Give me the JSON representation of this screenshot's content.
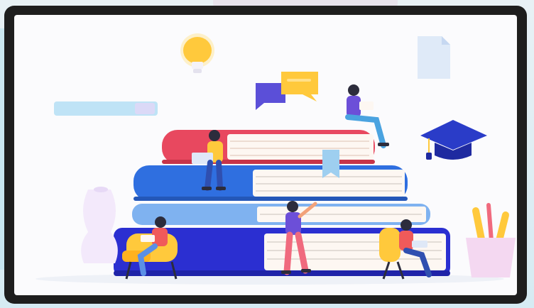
{
  "scene": {
    "colors": {
      "frame": "#1e1e1e",
      "screen": "#fbfbfd",
      "book_red": "#e8485f",
      "book_blue": "#2f6fe0",
      "book_light_blue": "#7fb2f0",
      "book_navy": "#2b2fd1",
      "pages": "#fdf7f2",
      "bulb": "#ffc93c",
      "accent_purple": "#6c4fd8",
      "skin": "#f2a27a"
    },
    "icons": [
      "lightbulb-icon",
      "chat-bubble-icon",
      "document-icon",
      "graduation-cap-icon",
      "pencil-cup-icon",
      "vase-icon"
    ]
  }
}
